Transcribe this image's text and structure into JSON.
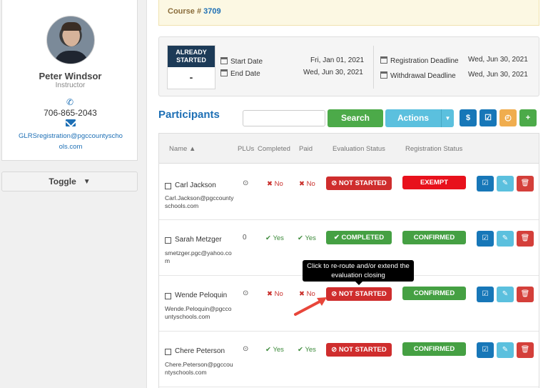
{
  "profile": {
    "name": "Peter Windsor",
    "role": "Instructor",
    "phone": "706-865-2043",
    "email": "GLRSregistration@pgccountyschools.com"
  },
  "sidebar": {
    "toggle_label": "Toggle"
  },
  "course": {
    "prefix": "Course # ",
    "number": "3709"
  },
  "status": {
    "line1": "ALREADY",
    "line2": "STARTED",
    "value": "-"
  },
  "dates": {
    "start_label": "Start Date",
    "start_value": "Fri, Jan 01, 2021",
    "end_label": "End Date",
    "end_value": "Wed, Jun 30, 2021",
    "reg_deadline_label": "Registration Deadline",
    "reg_deadline_value": "Wed, Jun 30, 2021",
    "withdrawal_label": "Withdrawal Deadline",
    "withdrawal_value": "Wed, Jun 30, 2021"
  },
  "participants": {
    "title": "Participants",
    "search_label": "Search",
    "actions_label": "Actions",
    "columns": {
      "name": "Name",
      "plus": "PLUs",
      "completed": "Completed",
      "paid": "Paid",
      "eval": "Evaluation Status",
      "reg": "Registration Status"
    },
    "rows": [
      {
        "name": "Carl Jackson",
        "email": "Carl.Jackson@pgccountyschools.com",
        "plu": "⊙",
        "completed": "No",
        "paid": "No",
        "eval": "NOT STARTED",
        "reg": "EXEMPT"
      },
      {
        "name": "Sarah Metzger",
        "email": "smetzger.pgc@yahoo.com",
        "plu": "0",
        "completed": "Yes",
        "paid": "Yes",
        "eval": "COMPLETED",
        "reg": "CONFIRMED"
      },
      {
        "name": "Wende Peloquin",
        "email": "Wende.Peloquin@pgccountyschools.com",
        "plu": "⊙",
        "completed": "No",
        "paid": "No",
        "eval": "NOT STARTED",
        "reg": "CONFIRMED"
      },
      {
        "name": "Chere Peterson",
        "email": "Chere.Peterson@pgccountyschools.com",
        "plu": "⊙",
        "completed": "Yes",
        "paid": "Yes",
        "eval": "NOT STARTED",
        "reg": "CONFIRMED"
      }
    ]
  },
  "tooltip": {
    "text": "Click to re-route and/or extend the evaluation closing"
  },
  "icons": {
    "phone": "phone-icon",
    "mail": "mail-icon",
    "calendar": "calendar-icon",
    "dollar": "dollar-icon",
    "check": "check-square-icon",
    "clock": "clock-icon",
    "add_user": "add-user-icon",
    "edit": "pencil-icon",
    "delete": "trash-icon"
  },
  "colors": {
    "brand_blue": "#1d6fb5",
    "success": "#4caa49",
    "info": "#5bc0de",
    "danger": "#cf2d2d",
    "warning": "#f0ad4e",
    "navy": "#1c3a57"
  }
}
